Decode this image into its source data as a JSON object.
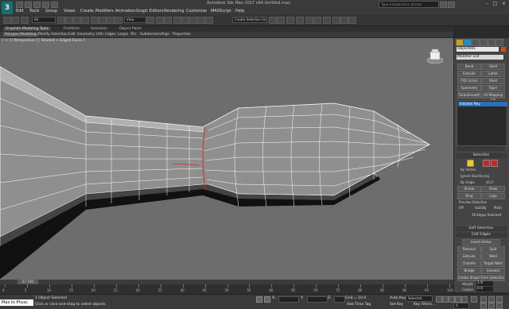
{
  "title": "Autodesk 3ds Max 2017 x64    Untitled.max",
  "app_logo": "3",
  "search_placeholder": "Type a keyword or phrase",
  "menu": [
    "Edit",
    "Tools",
    "Group",
    "Views",
    "Create",
    "Modifiers",
    "Animation",
    "Graph Editors",
    "Rendering",
    "Customize",
    "MAXScript",
    "Help"
  ],
  "toolbar": {
    "filter": "All",
    "view": "View",
    "selection_set": "Create Selection Se"
  },
  "ribbon_tabs": [
    "Graphite Modeling Tools",
    "Freeform",
    "Selection",
    "Object Paint"
  ],
  "ribbon_sub": [
    "Polygon Modeling",
    "Modify Selection",
    "Edit",
    "Geometry (All)",
    "Edges",
    "Loops",
    "Tris",
    "Subdivision",
    "Align",
    "Properties"
  ],
  "viewport_label": "[ + ] [ Perspective ] [ Shaded + Edged Faces ]",
  "panel": {
    "object_name": "Object001",
    "modifier_list": "Modifier List",
    "modifier_buttons": [
      "Bend",
      "Shell",
      "Extrude",
      "Lathe",
      "FFD 3x3x3",
      "Shell",
      "Symmetry",
      "Taper",
      "TurboSmooth",
      "UV Mapping Cle"
    ],
    "stack_item": "Editable Poly",
    "selection_head": "Selection",
    "by_vertex": "By Vertex",
    "ignore_backfacing": "Ignore Backfacing",
    "by_angle": "By Angle",
    "angle_value": "45.0",
    "shrink": "Shrink",
    "grow": "Grow",
    "ring": "Ring",
    "loop": "Loop",
    "preview_selection": "Preview Selection",
    "preview_options": [
      "Off",
      "SubObj",
      "Multi"
    ],
    "selected_info": "36 Edges Selected",
    "soft_selection": "Soft Selection",
    "edit_edges": "Edit Edges",
    "insert_vertex": "Insert Vertex",
    "remove": "Remove",
    "split": "Split",
    "extrude": "Extrude",
    "weld": "Weld",
    "chamfer": "Chamfer",
    "target_weld": "Target Weld",
    "bridge": "Bridge",
    "connect": "Connect",
    "create_shape": "Create Shape From Selection",
    "weight_label": "Weight",
    "weight_value": "1.0",
    "crease_label": "Crease",
    "crease_value": "0.0"
  },
  "timeline": {
    "range": "0 / 100",
    "ticks": [
      "0",
      "5",
      "10",
      "15",
      "20",
      "25",
      "30",
      "35",
      "40",
      "45",
      "50",
      "55",
      "60",
      "65",
      "70",
      "75",
      "80",
      "85",
      "90",
      "95",
      "100"
    ]
  },
  "status": {
    "maxscript": "Max to Physc",
    "objects_selected": "1 Object Selected",
    "prompt": "Click or click-and-drag to select objects",
    "x_label": "X:",
    "y_label": "Y:",
    "z_label": "Z:",
    "grid": "Grid = 10.0",
    "add_time_tag": "Add Time Tag",
    "auto_key": "Auto Key",
    "selected": "Selected",
    "set_key": "Set Key",
    "key_filters": "Key Filters...",
    "frame": "0"
  }
}
